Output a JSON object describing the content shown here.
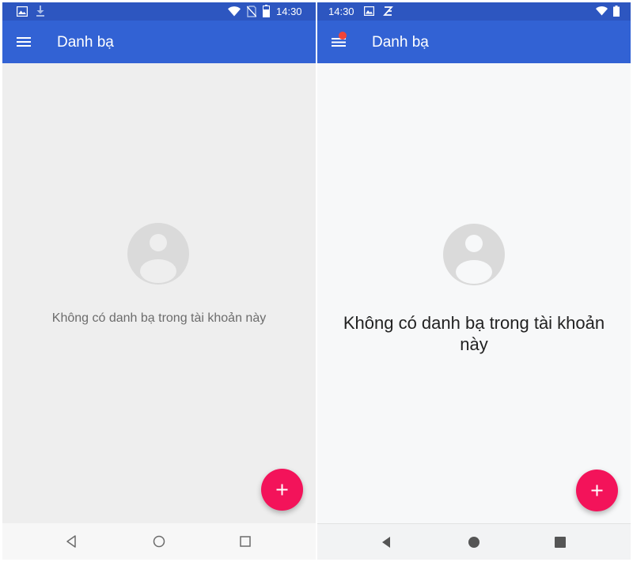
{
  "left_screen": {
    "status_bar": {
      "time": "14:30"
    },
    "app_bar": {
      "title": "Danh bạ"
    },
    "empty_state": {
      "message": "Không có danh bạ trong tài khoản này"
    },
    "fab": {
      "icon": "plus-icon"
    },
    "nav_bar": {
      "buttons": [
        "back-icon",
        "home-icon",
        "recents-icon"
      ]
    }
  },
  "right_screen": {
    "status_bar": {
      "time": "14:30"
    },
    "app_bar": {
      "title": "Danh bạ",
      "notification_dot": true
    },
    "empty_state": {
      "message_line1": "Không có danh bạ trong tài khoản",
      "message_line2": "này"
    },
    "fab": {
      "icon": "plus-icon"
    },
    "nav_bar": {
      "buttons": [
        "back-icon",
        "home-icon",
        "recents-icon"
      ]
    }
  },
  "colors": {
    "status_bar": "#2d56c0",
    "app_bar": "#3262d4",
    "fab": "#f3135a",
    "avatar": "#dadada",
    "notification_dot": "#f0443a"
  }
}
